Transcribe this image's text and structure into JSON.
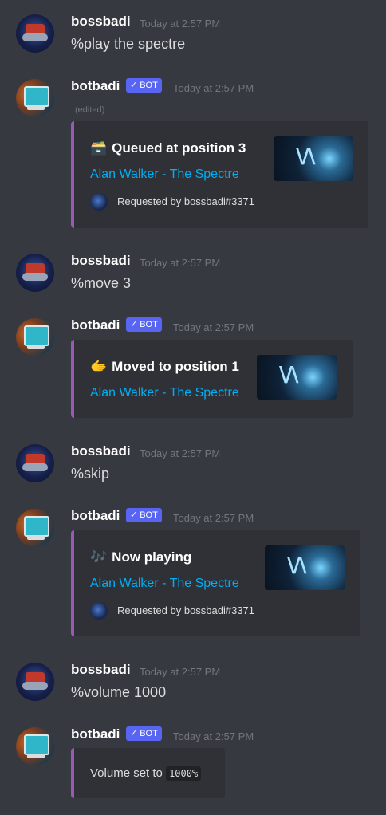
{
  "accent": "#9b59b6",
  "link_color": "#00aff4",
  "bot_badge_color": "#5865f2",
  "messages": [
    {
      "author": "bossbadi",
      "time": "Today at 2:57 PM",
      "text": "%play the spectre"
    },
    {
      "author": "botbadi",
      "badge": "BOT",
      "time": "Today at 2:57 PM",
      "edited": "(edited)",
      "embed": {
        "icon": "🗃️",
        "title": "Queued at position 3",
        "link": "Alan Walker - The Spectre",
        "footer": "Requested by bossbadi#3371"
      }
    },
    {
      "author": "bossbadi",
      "time": "Today at 2:57 PM",
      "text": "%move 3"
    },
    {
      "author": "botbadi",
      "badge": "BOT",
      "time": "Today at 2:57 PM",
      "embed": {
        "icon": "🫱",
        "title": "Moved to position 1",
        "link": "Alan Walker - The Spectre"
      }
    },
    {
      "author": "bossbadi",
      "time": "Today at 2:57 PM",
      "text": "%skip"
    },
    {
      "author": "botbadi",
      "badge": "BOT",
      "time": "Today at 2:57 PM",
      "embed": {
        "icon": "🎶",
        "title": "Now playing",
        "link": "Alan Walker - The Spectre",
        "footer": "Requested by bossbadi#3371"
      }
    },
    {
      "author": "bossbadi",
      "time": "Today at 2:57 PM",
      "text": "%volume 1000"
    },
    {
      "author": "botbadi",
      "badge": "BOT",
      "time": "Today at 2:57 PM",
      "embed": {
        "text_prefix": "Volume set to ",
        "code": "1000%"
      }
    }
  ]
}
